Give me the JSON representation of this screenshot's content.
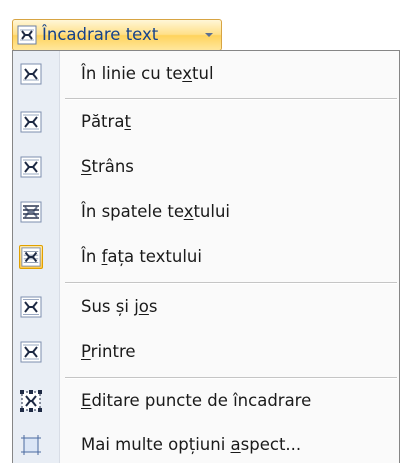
{
  "toolbar": {
    "button_label": "Încadrare text",
    "button_icon": "wrap-text-icon"
  },
  "menu": {
    "items": [
      {
        "pre": "În linie cu te",
        "acc": "x",
        "post": "tul",
        "icon": "wrap-inline-icon",
        "selected": false
      },
      {
        "pre": "Pătra",
        "acc": "t",
        "post": "",
        "icon": "wrap-square-icon",
        "selected": false
      },
      {
        "pre": "",
        "acc": "S",
        "post": "trâns",
        "icon": "wrap-tight-icon",
        "selected": false
      },
      {
        "pre": "În spatele te",
        "acc": "x",
        "post": "tului",
        "icon": "wrap-behind-text-icon",
        "selected": false
      },
      {
        "pre": "În ",
        "acc": "f",
        "post": "ața textului",
        "icon": "wrap-in-front-icon",
        "selected": true
      },
      {
        "pre": "Sus și j",
        "acc": "o",
        "post": "s",
        "icon": "wrap-top-bottom-icon",
        "selected": false
      },
      {
        "pre": "",
        "acc": "P",
        "post": "rintre",
        "icon": "wrap-through-icon",
        "selected": false
      },
      {
        "pre": "",
        "acc": "E",
        "post": "ditare puncte de încadrare",
        "icon": "edit-wrap-points-icon",
        "selected": false
      },
      {
        "pre": "Mai multe opțiuni ",
        "acc": "a",
        "post": "spect...",
        "icon": "more-layout-options-icon",
        "selected": false
      }
    ]
  }
}
